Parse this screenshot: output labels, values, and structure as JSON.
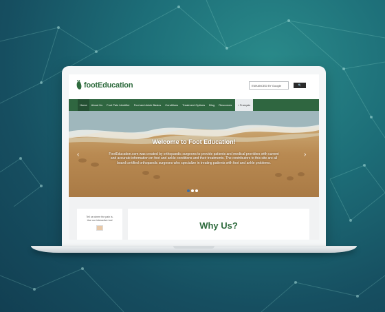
{
  "site": {
    "logo_prefix": "foot",
    "logo_suffix": "Education"
  },
  "search": {
    "value": "ENHANCED BY Google",
    "button_label": "🔍"
  },
  "nav": {
    "items": [
      {
        "label": "Home",
        "active": true
      },
      {
        "label": "About Us"
      },
      {
        "label": "Foot Pain Identifier"
      },
      {
        "label": "Foot and Ankle Basics"
      },
      {
        "label": "Conditions"
      },
      {
        "label": "Treatment Options"
      },
      {
        "label": "Blog"
      },
      {
        "label": "Resources"
      }
    ],
    "lang_label": "Français"
  },
  "hero": {
    "title": "Welcome to Foot Education!",
    "text": "FootEducation.com was created by orthopaedic surgeons to provide patients and medical providers with current and accurate information on foot and ankle conditions and their treatments. The contributors to this site are all board certified orthopaedic surgeons who specialize in treating patients with foot and ankle problems.",
    "prev_label": "‹",
    "next_label": "›"
  },
  "sidebar_card": {
    "line1": "Tell us where the pain is.",
    "line2": "Use our interactive tool"
  },
  "main_card": {
    "heading": "Why Us?"
  },
  "colors": {
    "brand_green": "#2e6b3d",
    "nav_bg": "#2f6640",
    "background": "#164e60"
  }
}
